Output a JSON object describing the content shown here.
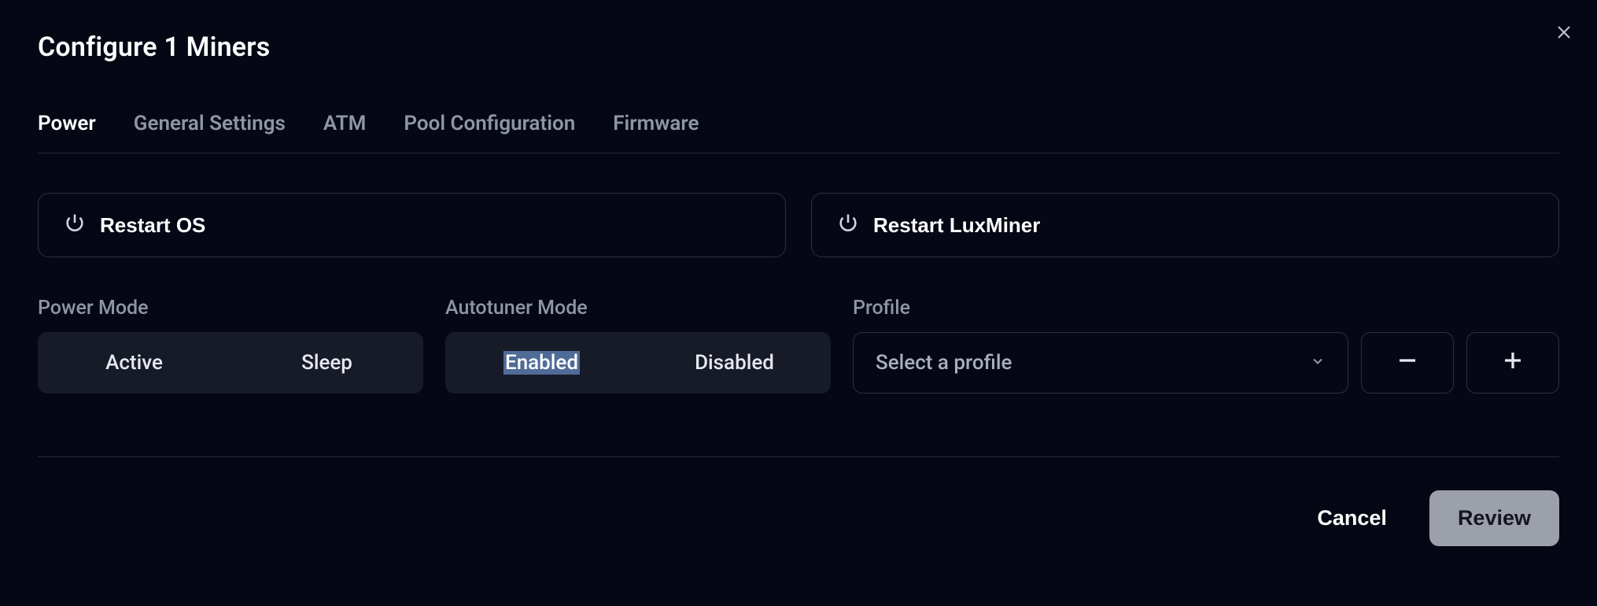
{
  "header": {
    "title": "Configure 1 Miners"
  },
  "tabs": {
    "items": [
      {
        "label": "Power",
        "active": true
      },
      {
        "label": "General Settings",
        "active": false
      },
      {
        "label": "ATM",
        "active": false
      },
      {
        "label": "Pool Configuration",
        "active": false
      },
      {
        "label": "Firmware",
        "active": false
      }
    ]
  },
  "restart": {
    "os_label": "Restart OS",
    "luxminer_label": "Restart LuxMiner"
  },
  "power_mode": {
    "label": "Power Mode",
    "options": {
      "active": "Active",
      "sleep": "Sleep"
    }
  },
  "autotuner": {
    "label": "Autotuner Mode",
    "options": {
      "enabled": "Enabled",
      "disabled": "Disabled"
    },
    "selected_option": "enabled",
    "text_highlighted": true
  },
  "profile": {
    "label": "Profile",
    "placeholder": "Select a profile"
  },
  "footer": {
    "cancel_label": "Cancel",
    "review_label": "Review"
  },
  "icons": {
    "close": "close-icon",
    "power": "power-icon",
    "chevron_down": "chevron-down-icon",
    "minus": "minus-icon",
    "plus": "plus-icon"
  }
}
